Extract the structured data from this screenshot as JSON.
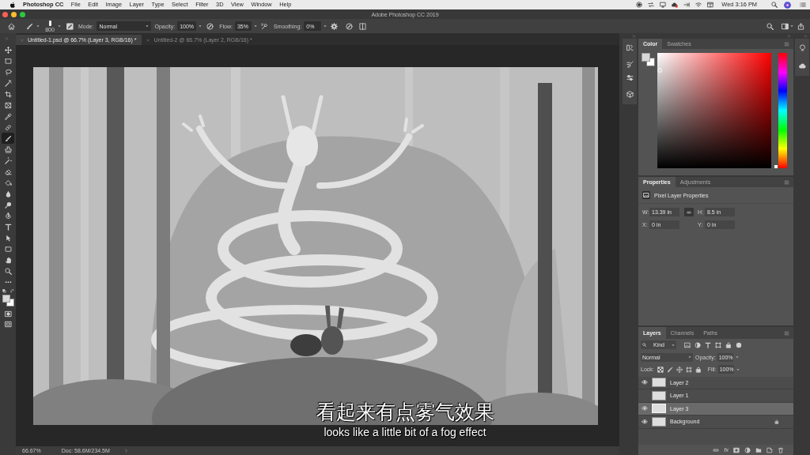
{
  "menu_bar": {
    "app_name": "Photoshop CC",
    "items": [
      "File",
      "Edit",
      "Image",
      "Layer",
      "Type",
      "Select",
      "Filter",
      "3D",
      "View",
      "Window",
      "Help"
    ],
    "clock": "Wed 3:16 PM"
  },
  "window": {
    "title": "Adobe Photoshop CC 2019"
  },
  "options_bar": {
    "brush_size": "800",
    "mode": {
      "label": "Mode:",
      "value": "Normal"
    },
    "opacity": {
      "label": "Opacity:",
      "value": "100%"
    },
    "flow": {
      "label": "Flow:",
      "value": "35%"
    },
    "smoothing": {
      "label": "Smoothing:",
      "value": "0%"
    }
  },
  "tools": [
    {
      "kind": "move",
      "selected": false
    },
    {
      "kind": "marquee",
      "selected": false
    },
    {
      "kind": "lasso",
      "selected": false
    },
    {
      "kind": "wand",
      "selected": false
    },
    {
      "kind": "crop",
      "selected": false
    },
    {
      "kind": "frame",
      "selected": false
    },
    {
      "kind": "eyedropper",
      "selected": false
    },
    {
      "kind": "healing",
      "selected": false
    },
    {
      "kind": "brush",
      "selected": true
    },
    {
      "kind": "stamp",
      "selected": false
    },
    {
      "kind": "history",
      "selected": false
    },
    {
      "kind": "eraser",
      "selected": false
    },
    {
      "kind": "bucket",
      "selected": false
    },
    {
      "kind": "blur",
      "selected": false
    },
    {
      "kind": "dodge",
      "selected": false
    },
    {
      "kind": "pen",
      "selected": false
    },
    {
      "kind": "type",
      "selected": false
    },
    {
      "kind": "select",
      "selected": false
    },
    {
      "kind": "shape",
      "selected": false
    },
    {
      "kind": "hand",
      "selected": false
    },
    {
      "kind": "zoom",
      "selected": false
    },
    {
      "kind": "more",
      "selected": false
    }
  ],
  "document_tabs": [
    {
      "label": "Untitled-1.psd @ 66.7% (Layer 3, RGB/16) *",
      "selected": true
    },
    {
      "label": "Untitled-2 @ 66.7% (Layer 2, RGB/16) *",
      "selected": false
    }
  ],
  "subtitles": [
    "看起来有点雾气效果",
    "looks like a little bit of a fog effect"
  ],
  "status_bar": {
    "zoom": "66.67%",
    "doc_size": "Doc: 58.6M/234.5M"
  },
  "color_panel": {
    "tabs": [
      {
        "label": "Color",
        "selected": true
      },
      {
        "label": "Swatches",
        "selected": false
      }
    ],
    "hue_slider": {
      "level": 0
    }
  },
  "properties_panel": {
    "tabs": [
      {
        "label": "Properties",
        "selected": true
      },
      {
        "label": "Adjustments",
        "selected": false
      }
    ],
    "heading": "Pixel Layer Properties",
    "fields": [
      {
        "label": "W:",
        "value": "13.39 in"
      },
      {
        "label": "H:",
        "value": "8.5 in"
      },
      {
        "label": "X:",
        "value": "0 in"
      },
      {
        "label": "Y:",
        "value": "0 in"
      }
    ],
    "linked": true
  },
  "layers_panel": {
    "tabs": [
      {
        "label": "Layers",
        "selected": true
      },
      {
        "label": "Channels",
        "selected": false
      },
      {
        "label": "Paths",
        "selected": false
      }
    ],
    "filter_kind": "Kind",
    "blend_mode": "Normal",
    "opacity": {
      "label": "Opacity:",
      "value": "100%"
    },
    "lock_label": "Lock:",
    "fill": {
      "label": "Fill:",
      "value": "100%"
    },
    "layers": [
      {
        "name": "Layer 2",
        "visible": true,
        "selected": false,
        "locked": false
      },
      {
        "name": "Layer 1",
        "visible": false,
        "selected": false,
        "locked": false
      },
      {
        "name": "Layer 3",
        "visible": true,
        "selected": true,
        "locked": false
      },
      {
        "name": "Background",
        "visible": true,
        "selected": false,
        "locked": true
      }
    ],
    "effects_button": "fx"
  }
}
